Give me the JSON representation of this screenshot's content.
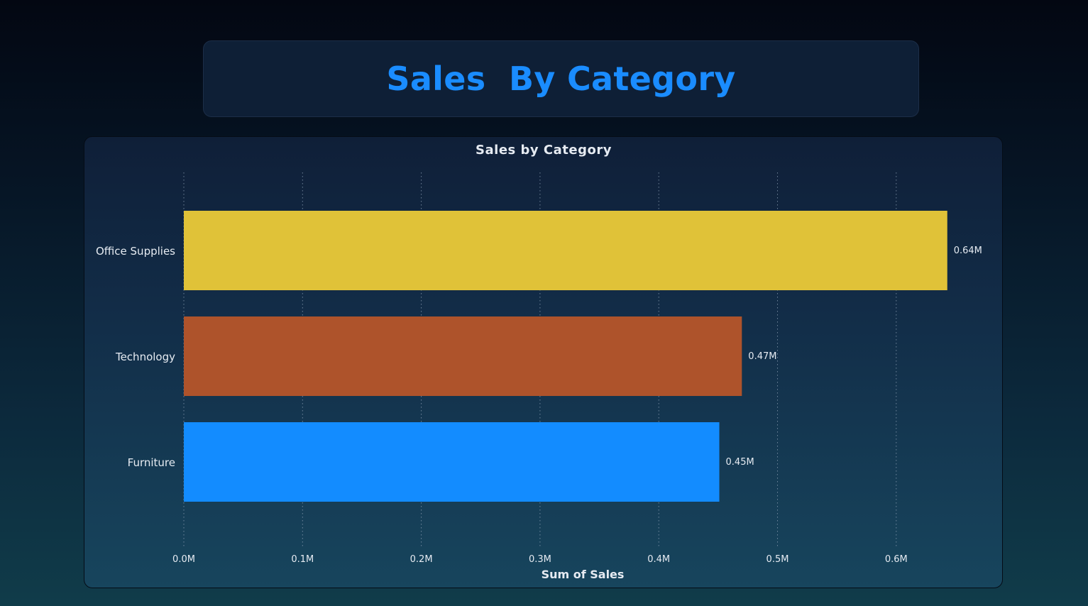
{
  "page": {
    "title": "Sales  By Category"
  },
  "chart_data": {
    "type": "bar",
    "orientation": "horizontal",
    "title": "Sales by Category",
    "xlabel": "Sum of Sales",
    "ylabel": "",
    "categories": [
      "Office Supplies",
      "Technology",
      "Furniture"
    ],
    "values": [
      0.643,
      0.47,
      0.451
    ],
    "data_labels": [
      "0.64M",
      "0.47M",
      "0.45M"
    ],
    "colors": [
      "#e0c238",
      "#ae532b",
      "#138cff"
    ],
    "xlim": [
      0,
      0.6
    ],
    "x_ticks": [
      0,
      0.1,
      0.2,
      0.3,
      0.4,
      0.5,
      0.6
    ],
    "x_tick_labels": [
      "0.0M",
      "0.1M",
      "0.2M",
      "0.3M",
      "0.4M",
      "0.5M",
      "0.6M"
    ],
    "grid": "vertical-dotted",
    "legend": "none"
  }
}
